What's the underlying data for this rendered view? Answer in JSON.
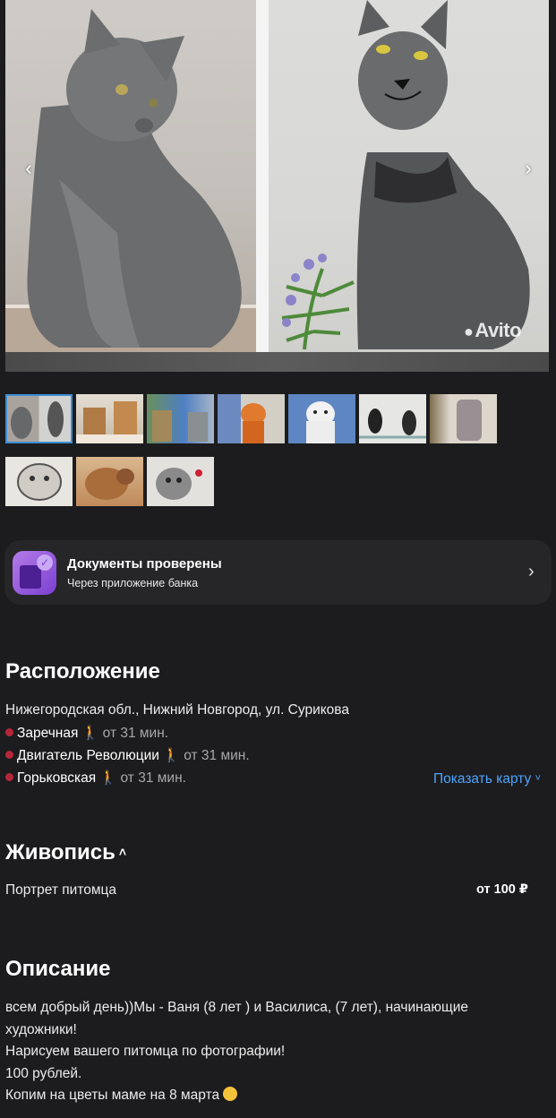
{
  "gallery": {
    "prev_icon": "chevron-left-icon",
    "next_icon": "chevron-right-icon",
    "watermark": "Avito",
    "thumbnail_count": 10
  },
  "docs": {
    "title": "Документы проверены",
    "subtitle": "Через приложение банка",
    "icon": "verified-document-icon",
    "accent": "#7a3fd1"
  },
  "location": {
    "heading": "Расположение",
    "address": "Нижегородская обл., Нижний Новгород, ул. Сурикова",
    "stations": [
      {
        "name": "Заречная",
        "distance": "от 31 мин."
      },
      {
        "name": "Двигатель Революции",
        "distance": "от 31 мин."
      },
      {
        "name": "Горьковская",
        "distance": "от 31 мин."
      }
    ],
    "show_map": "Показать карту",
    "metro_color": "#b5263a"
  },
  "category": {
    "heading": "Живопись",
    "service": "Портрет питомца",
    "price": "от 100 ₽"
  },
  "description": {
    "heading": "Описание",
    "lines": [
      "всем добрый день))Мы - Ваня (8 лет ) и Василиса, (7 лет), начинающие",
      "художники!",
      "Нарисуем вашего питомца по фотографии!",
      "100 рублей.",
      "Копим на цветы маме на 8 марта"
    ]
  },
  "colors": {
    "background": "#1c1c1e",
    "link": "#4ea4ff"
  }
}
